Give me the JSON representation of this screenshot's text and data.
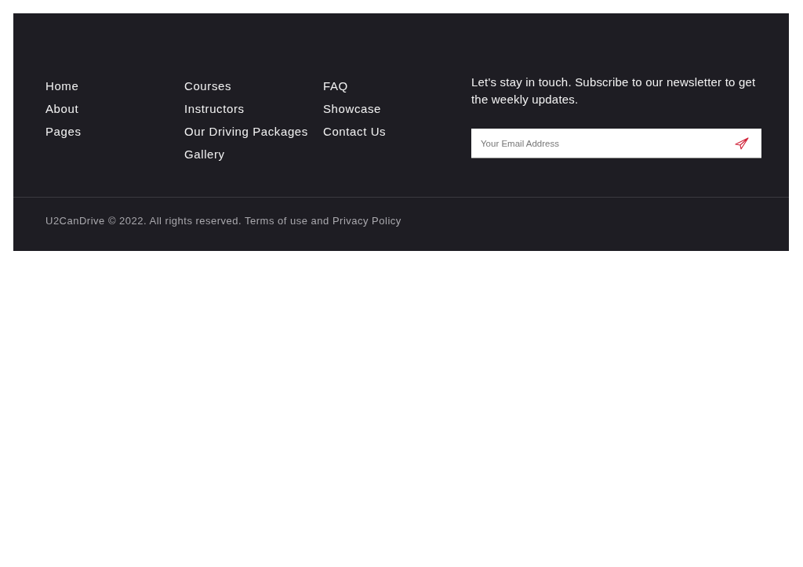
{
  "footer": {
    "link_columns": [
      {
        "links": [
          "Home",
          "About",
          "Pages"
        ]
      },
      {
        "links": [
          "Courses",
          "Instructors",
          "Our Driving Packages",
          "Gallery"
        ]
      },
      {
        "links": [
          "FAQ",
          "Showcase",
          "Contact Us"
        ]
      }
    ],
    "newsletter": {
      "text": "Let's stay in touch. Subscribe to our newsletter to get the weekly updates.",
      "email_field": {
        "placeholder": "Your Email Address"
      }
    },
    "copyright": "U2CanDrive © 2022. All rights reserved. Terms of use and Privacy Policy"
  }
}
